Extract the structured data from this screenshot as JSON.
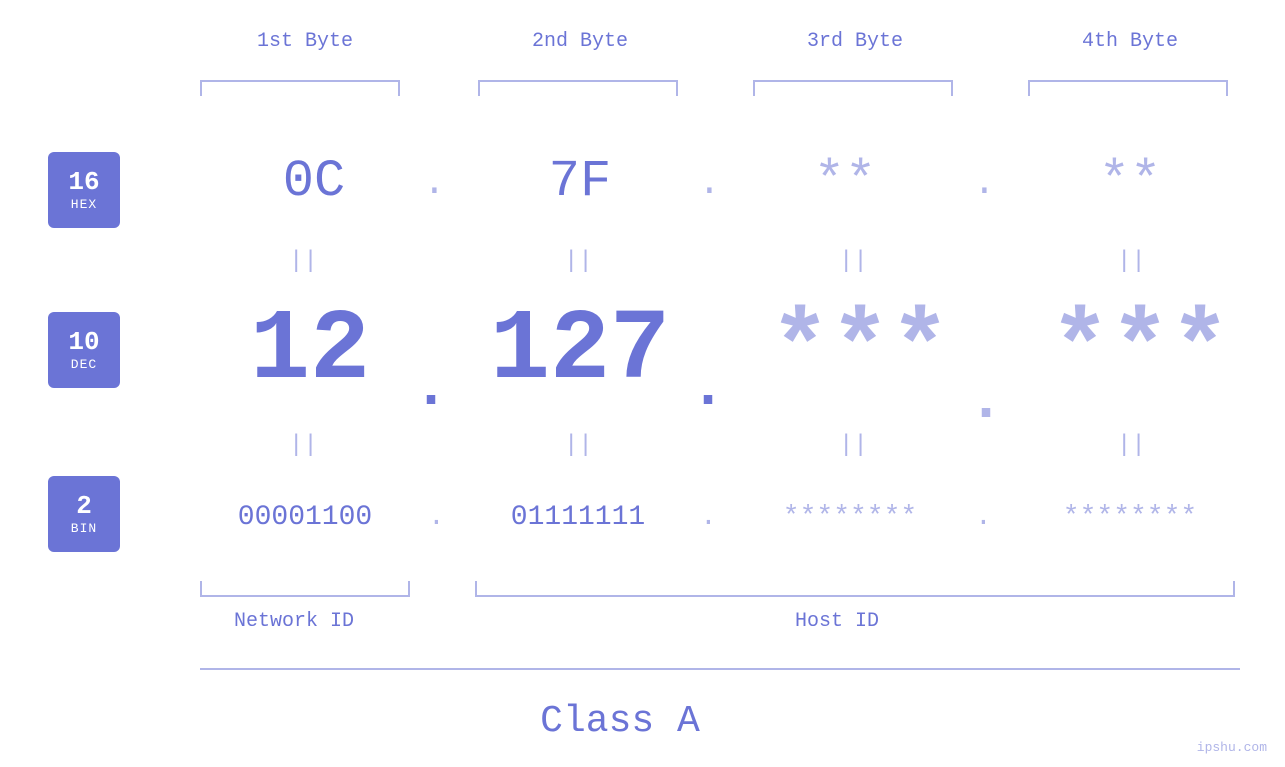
{
  "badges": {
    "hex": {
      "number": "16",
      "label": "HEX"
    },
    "dec": {
      "number": "10",
      "label": "DEC"
    },
    "bin": {
      "number": "2",
      "label": "BIN"
    }
  },
  "columns": {
    "col1": "1st Byte",
    "col2": "2nd Byte",
    "col3": "3rd Byte",
    "col4": "4th Byte"
  },
  "hex_values": {
    "v1": "0C",
    "v2": "7F",
    "v3": "**",
    "v4": "**",
    "dots": "."
  },
  "dec_values": {
    "v1": "12",
    "v2": "127",
    "v3": "***",
    "v4": "***",
    "dots": "."
  },
  "bin_values": {
    "v1": "00001100",
    "v2": "01111111",
    "v3": "********",
    "v4": "********",
    "dots": "."
  },
  "equals": "||",
  "labels": {
    "network_id": "Network ID",
    "host_id": "Host ID",
    "class": "Class A"
  },
  "watermark": "ipshu.com"
}
